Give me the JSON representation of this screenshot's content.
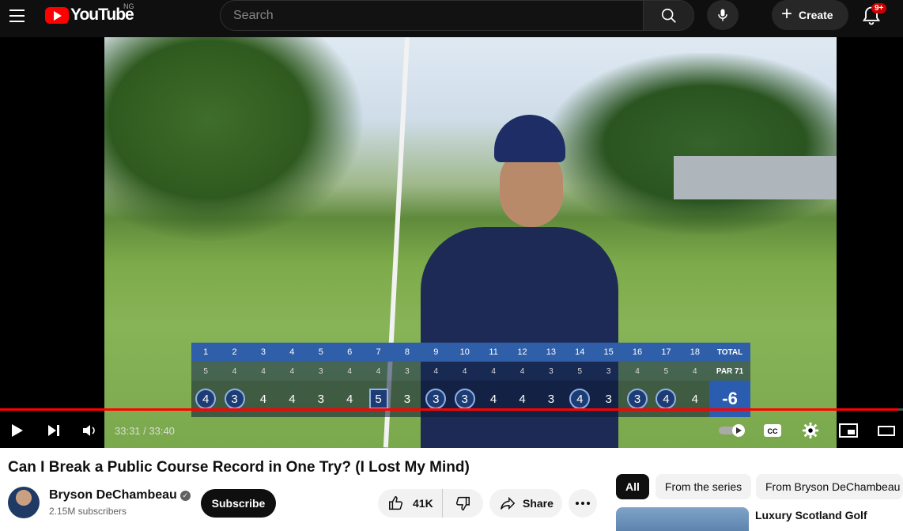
{
  "header": {
    "logo_text": "YouTube",
    "country_code": "NG",
    "search_placeholder": "Search",
    "create_label": "Create",
    "notifications_badge": "9+"
  },
  "player": {
    "current_time": "33:31",
    "duration": "33:40",
    "time_display": "33:31 / 33:40",
    "progress": 0.995,
    "scoreboard": {
      "holes": [
        "1",
        "2",
        "3",
        "4",
        "5",
        "6",
        "7",
        "8",
        "9",
        "10",
        "11",
        "12",
        "13",
        "14",
        "15",
        "16",
        "17",
        "18"
      ],
      "total_label": "TOTAL",
      "pars": [
        "5",
        "4",
        "4",
        "4",
        "3",
        "4",
        "4",
        "3",
        "4",
        "4",
        "4",
        "4",
        "3",
        "5",
        "3",
        "4",
        "5",
        "4"
      ],
      "par_total": "PAR 71",
      "scores": [
        "4",
        "3",
        "4",
        "4",
        "3",
        "4",
        "5",
        "3",
        "3",
        "3",
        "4",
        "4",
        "3",
        "4",
        "3",
        "3",
        "4",
        "4"
      ],
      "score_marks": [
        "circle",
        "circle",
        "",
        "",
        "",
        "",
        "box",
        "",
        "circle",
        "circle",
        "",
        "",
        "",
        "circle",
        "",
        "circle",
        "circle",
        ""
      ],
      "total_score": "-6"
    }
  },
  "video": {
    "title": "Can I Break a Public Course Record in One Try? (I Lost My Mind)",
    "channel_name": "Bryson DeChambeau",
    "subscribers": "2.15M subscribers",
    "subscribe_label": "Subscribe",
    "like_count": "41K",
    "share_label": "Share"
  },
  "sidebar": {
    "chips": [
      {
        "label": "All",
        "active": true
      },
      {
        "label": "From the series",
        "active": false
      },
      {
        "label": "From Bryson DeChambeau",
        "active": false
      }
    ],
    "first_recommendation_title": "Luxury Scotland Golf"
  },
  "colors": {
    "accent": "#ff0000",
    "scoreboard_blue": "#2f5fa8"
  }
}
